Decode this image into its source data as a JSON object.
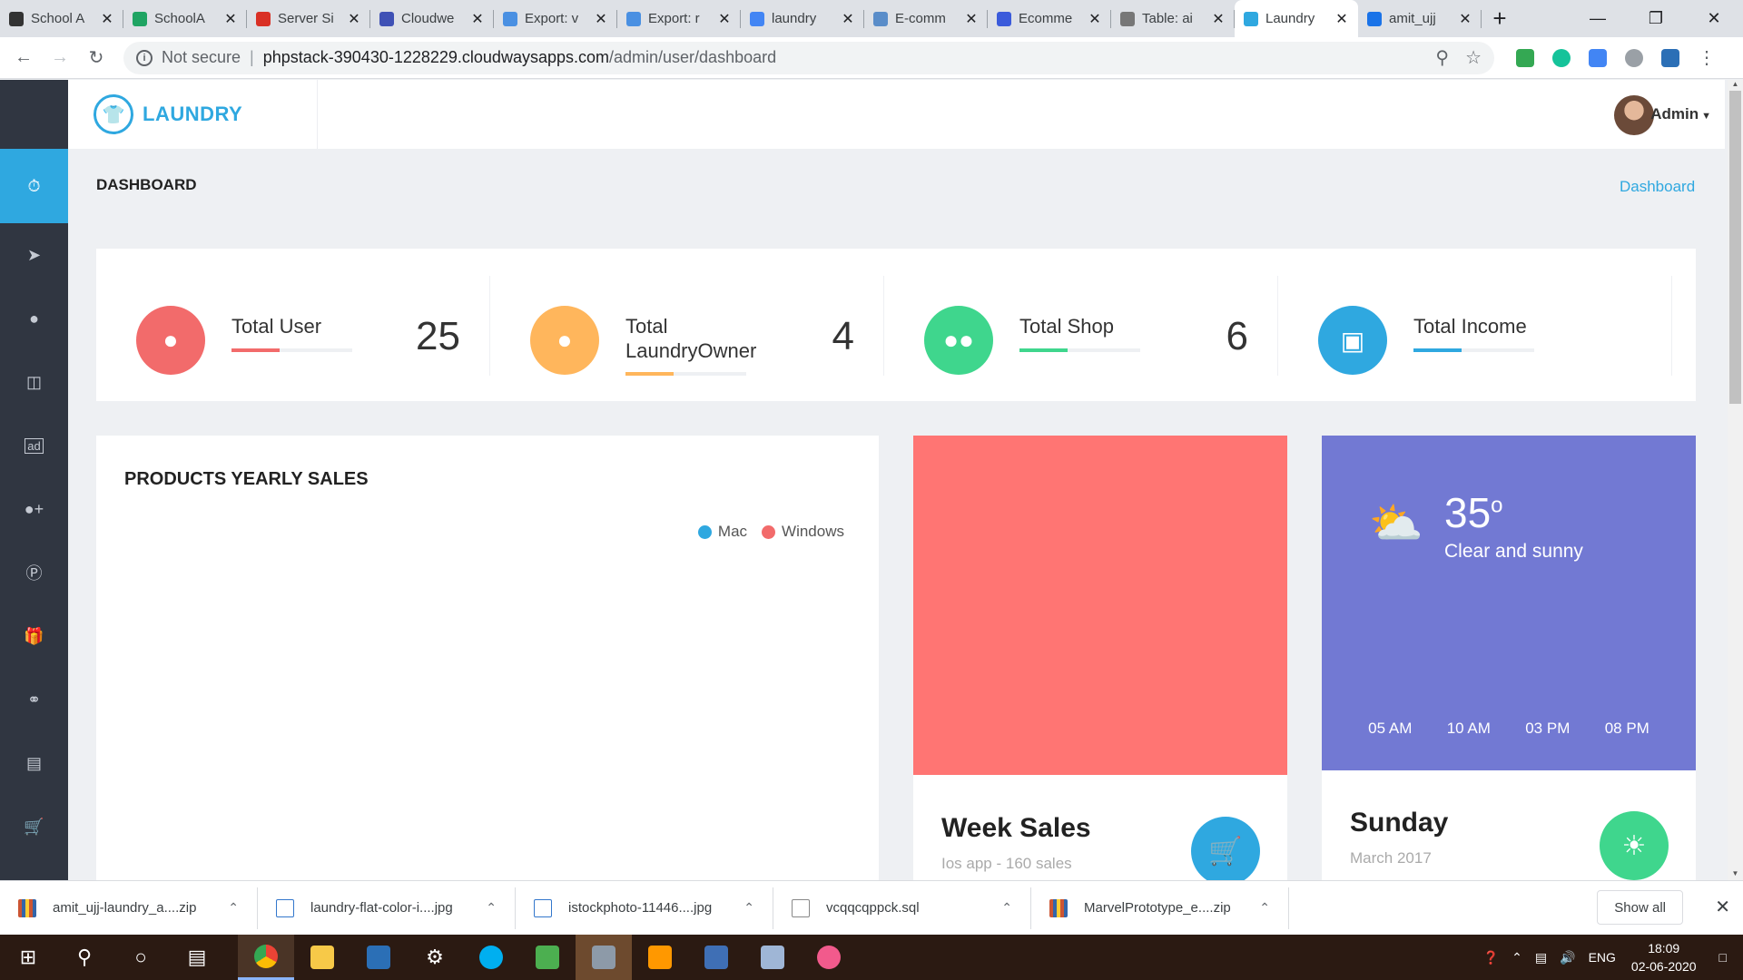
{
  "browser": {
    "tabs": [
      {
        "title": "School A",
        "color": "#333333"
      },
      {
        "title": "SchoolA",
        "color": "#1fa463"
      },
      {
        "title": "Server Si",
        "color": "#d93025"
      },
      {
        "title": "Cloudwe",
        "color": "#3f51b5"
      },
      {
        "title": "Export: v",
        "color": "#4a90e2"
      },
      {
        "title": "Export: r",
        "color": "#4a90e2"
      },
      {
        "title": "laundry",
        "color": "#4285f4"
      },
      {
        "title": "E-comm",
        "color": "#5a8dc9"
      },
      {
        "title": "Ecomme",
        "color": "#3b5bdb"
      },
      {
        "title": "Table: ai",
        "color": "#777777"
      },
      {
        "title": "Laundry",
        "color": "#2fa8e0",
        "active": true
      },
      {
        "title": "amit_ujj",
        "color": "#1a73e8"
      }
    ],
    "address": {
      "security": "Not secure",
      "host": "phpstack-390430-1228229.cloudwaysapps.com",
      "path": "/admin/user/dashboard"
    }
  },
  "app": {
    "brand": "LAUNDRY",
    "user": "Admin",
    "page_title": "DASHBOARD",
    "breadcrumb": "Dashboard",
    "sidebar_icons": [
      "dashboard-icon",
      "send-icon",
      "user-icon",
      "layout-icon",
      "ad-icon",
      "add-user-icon",
      "parking-icon",
      "gift-icon",
      "ticket-icon",
      "document-icon",
      "cart-icon"
    ],
    "stats": [
      {
        "label": "Total User",
        "value": "25",
        "color": "#f26b6b",
        "progress": 0.4
      },
      {
        "label": "Total LaundryOwner",
        "value": "4",
        "color": "#ffb65c",
        "progress": 0.4
      },
      {
        "label": "Total Shop",
        "value": "6",
        "color": "#3fd68d",
        "progress": 0.4
      },
      {
        "label": "Total Income",
        "value": "",
        "color": "#2fa8e0",
        "progress": 0.4
      }
    ],
    "sales_card": {
      "title": "PRODUCTS YEARLY SALES",
      "legend": [
        {
          "name": "Mac",
          "color": "#2fa8e0"
        },
        {
          "name": "Windows",
          "color": "#f26b6b"
        }
      ]
    },
    "week_card": {
      "title": "Week Sales",
      "subtitle": "Ios app - 160 sales",
      "top_color": "#ff7573",
      "button_color": "#2fa8e0"
    },
    "weather_card": {
      "temp": "35",
      "deg": "o",
      "desc": "Clear and sunny",
      "times": [
        "05 AM",
        "10 AM",
        "03 PM",
        "08 PM"
      ],
      "day": "Sunday",
      "date": "March 2017",
      "top_color": "#7279d3",
      "button_color": "#3fd68d"
    }
  },
  "downloads": {
    "items": [
      {
        "name": "amit_ujj-laundry_a....zip",
        "type": "zip"
      },
      {
        "name": "laundry-flat-color-i....jpg",
        "type": "img"
      },
      {
        "name": "istockphoto-11446....jpg",
        "type": "img"
      },
      {
        "name": "vcqqcqppck.sql",
        "type": "file"
      },
      {
        "name": "MarvelPrototype_e....zip",
        "type": "zip"
      }
    ],
    "show_all": "Show all"
  },
  "taskbar": {
    "lang": "ENG",
    "time": "18:09",
    "date": "02-06-2020"
  }
}
